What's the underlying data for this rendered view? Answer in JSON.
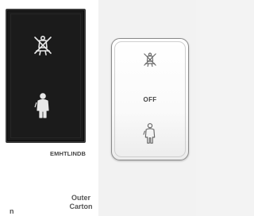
{
  "products": [
    {
      "model": "EMHTLINDB",
      "plate_color": "#1b1b1b",
      "icon_color": "#e8e8e8",
      "icons": [
        "no-attendant-bell-icon",
        "attendant-icon"
      ]
    },
    {
      "plate_color": "#ffffff",
      "icon_color": "#666666",
      "center_text": "OFF",
      "icons": [
        "no-attendant-bell-icon",
        "attendant-icon"
      ]
    }
  ],
  "table": {
    "partial_header": "n",
    "outer_carton_header": "Outer Carton"
  }
}
